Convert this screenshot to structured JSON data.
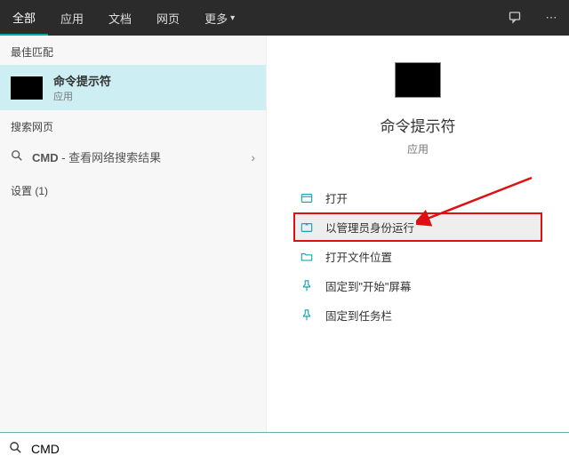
{
  "topbar": {
    "tabs": [
      "全部",
      "应用",
      "文档",
      "网页",
      "更多"
    ]
  },
  "left": {
    "best_match_header": "最佳匹配",
    "best_match": {
      "title": "命令提示符",
      "sub": "应用"
    },
    "search_web_header": "搜索网页",
    "search_web": {
      "query": "CMD",
      "suffix": " - 查看网络搜索结果"
    },
    "settings_header": "设置 (1)"
  },
  "detail": {
    "title": "命令提示符",
    "sub": "应用",
    "actions": [
      "打开",
      "以管理员身份运行",
      "打开文件位置",
      "固定到\"开始\"屏幕",
      "固定到任务栏"
    ]
  },
  "search": {
    "value": "CMD"
  }
}
